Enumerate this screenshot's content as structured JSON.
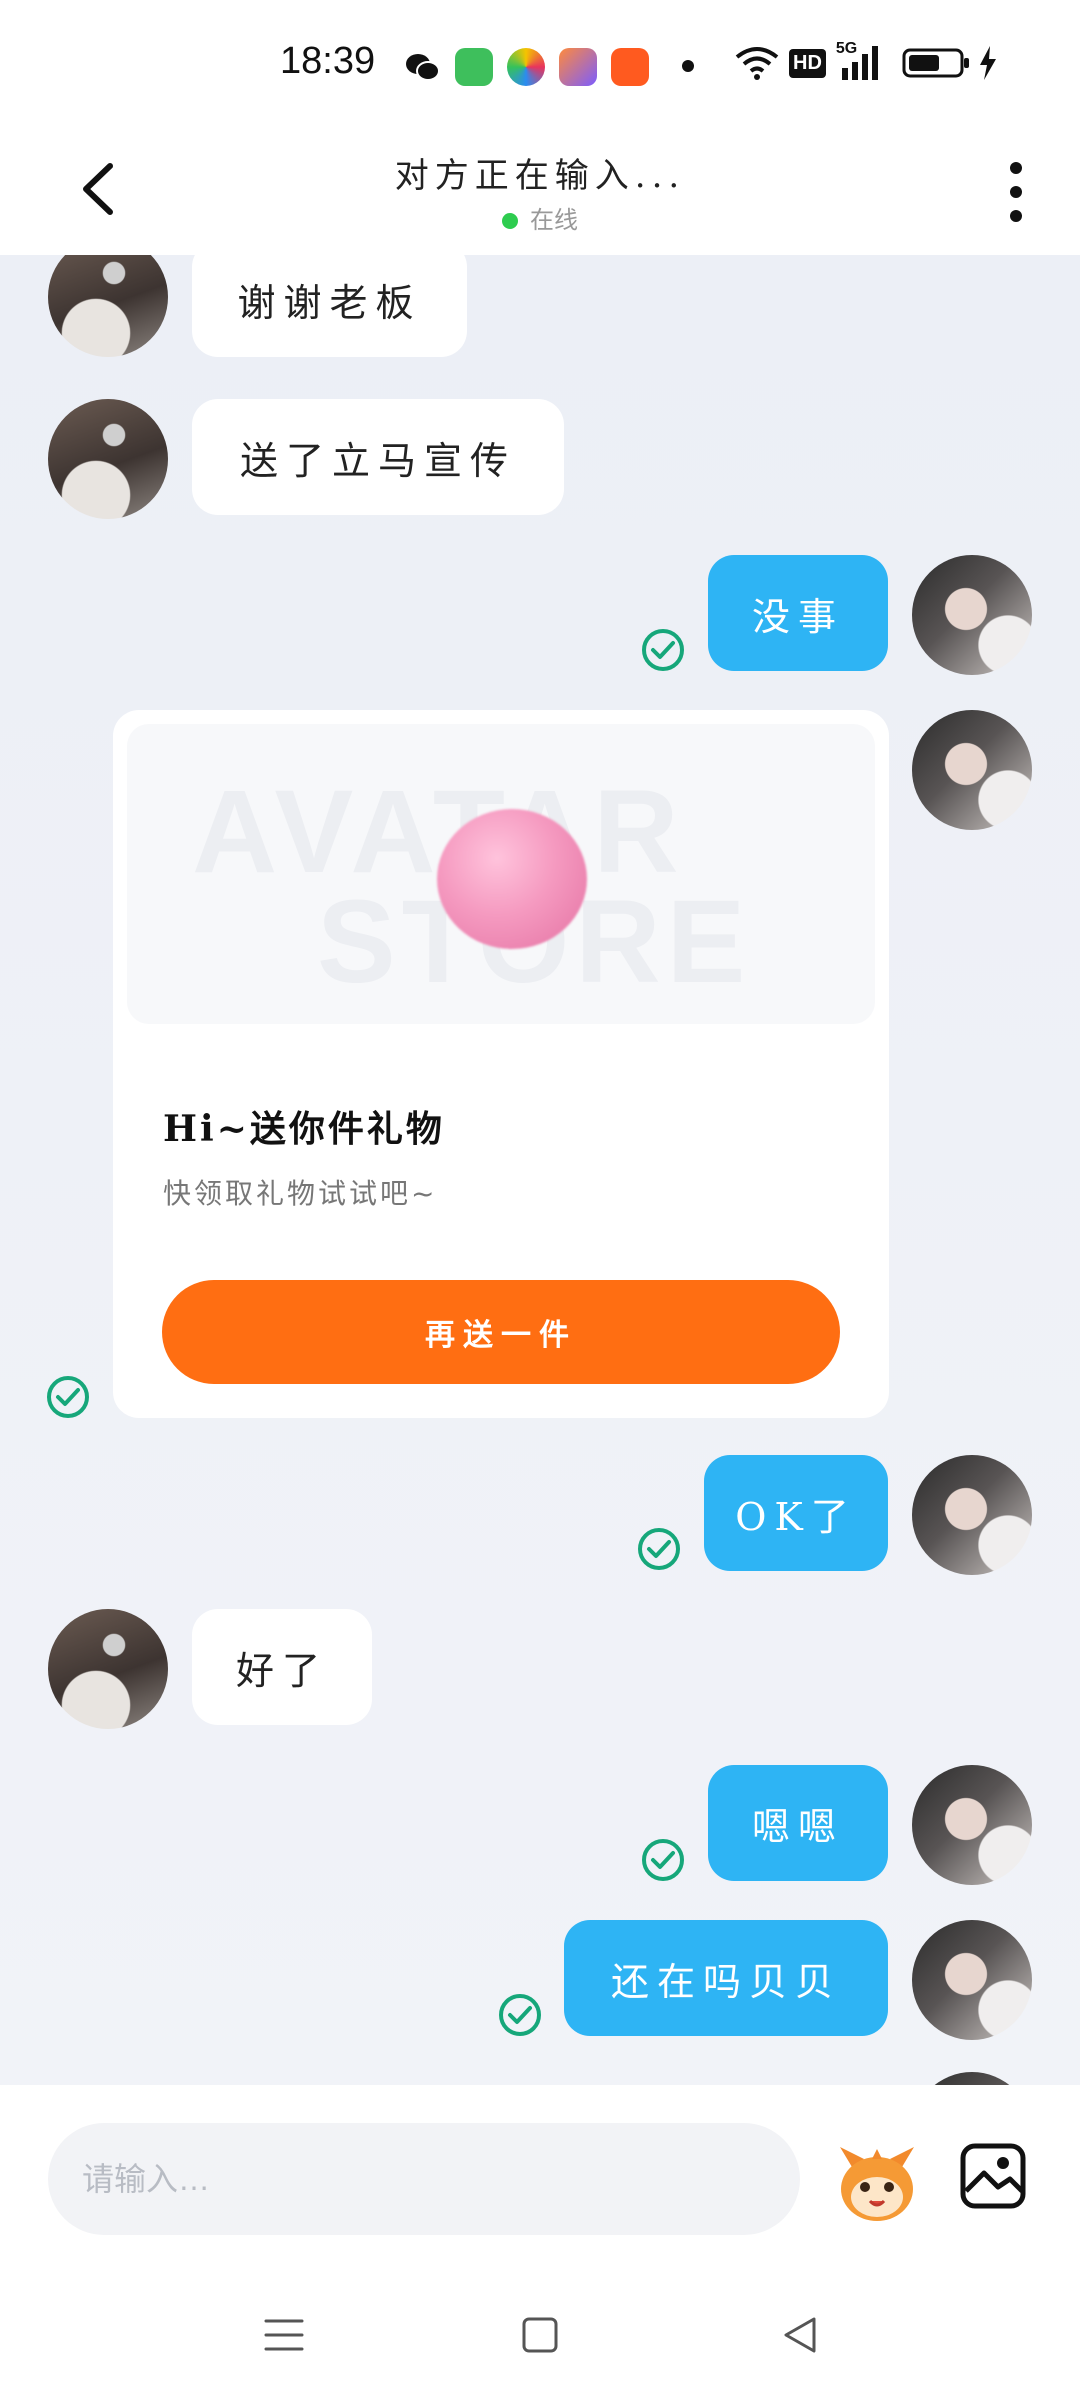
{
  "status_bar": {
    "time": "18:39",
    "badges": [
      "HD",
      "5G"
    ],
    "app_icons": [
      "wechat-icon",
      "app-store-icon",
      "kwai-icon",
      "shortcut-icon",
      "kuaishou-icon"
    ]
  },
  "header": {
    "title": "对方正在输入...",
    "presence": "在线",
    "presence_color": "#2ecc4f"
  },
  "messages": {
    "m1": "谢谢老板",
    "m2": "送了立马宣传",
    "m3": "没事",
    "m4": "OK了",
    "m5": "好了",
    "m6": "嗯嗯",
    "m7": "还在吗贝贝"
  },
  "gift_card": {
    "watermark_top": "AVATAR",
    "watermark_bottom": "STORE",
    "title": "Hi~送你件礼物",
    "subtitle": "快领取礼物试试吧~",
    "button": "再送一件"
  },
  "input_bar": {
    "placeholder": "请输入…"
  },
  "colors": {
    "outgoing_bubble": "#2eb4f4",
    "incoming_bubble": "#ffffff",
    "accent_button": "#ff6e12",
    "read_check": "#16a77a"
  }
}
